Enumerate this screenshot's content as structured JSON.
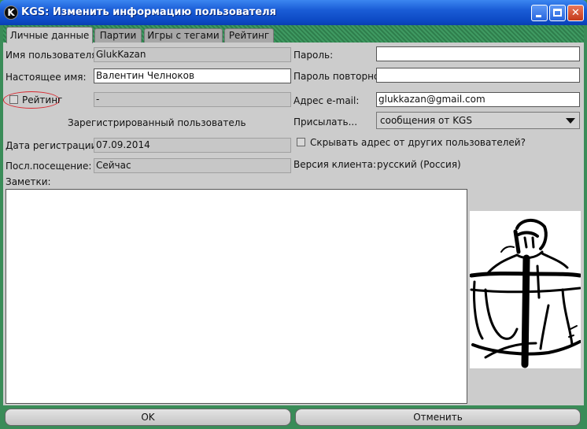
{
  "window": {
    "title": "KGS: Изменить информацию пользователя",
    "app_icon": "K"
  },
  "tabs": [
    {
      "label": "Личные данные",
      "active": true
    },
    {
      "label": "Партии",
      "active": false
    },
    {
      "label": "Игры с тегами",
      "active": false
    },
    {
      "label": "Рейтинг",
      "active": false
    }
  ],
  "form": {
    "username_label": "Имя пользователя:",
    "username_value": "GlukKazan",
    "realname_label": "Настоящее имя:",
    "realname_value": "Валентин Челноков",
    "rating_label": "Рейтинг",
    "rating_checked": false,
    "rating_value": "-",
    "registered_text": "Зарегистрированный пользователь",
    "regdate_label": "Дата регистрации:",
    "regdate_value": "07.09.2014",
    "lastvisit_label": "Посл.посещение:",
    "lastvisit_value": "Сейчас",
    "notes_label": "Заметки:",
    "notes_value": "",
    "password_label": "Пароль:",
    "password_value": "",
    "password_repeat_label": "Пароль повторно:",
    "password_repeat_value": "",
    "email_label": "Адрес e-mail:",
    "email_value": "glukkazan@gmail.com",
    "send_label": "Присылать...",
    "send_value": "сообщения от KGS",
    "hide_email_label": "Скрывать адрес от других пользователей?",
    "hide_email_checked": false,
    "client_version_label": "Версия клиента:",
    "client_version_value": "русский (Россия)"
  },
  "buttons": {
    "ok_label": "OK",
    "cancel_label": "Отменить"
  },
  "colors": {
    "titlebar": "#0b48c3",
    "panel_bg": "#cccccc",
    "frame_green": "#3a8c58",
    "highlight_oval": "#d8262e"
  }
}
